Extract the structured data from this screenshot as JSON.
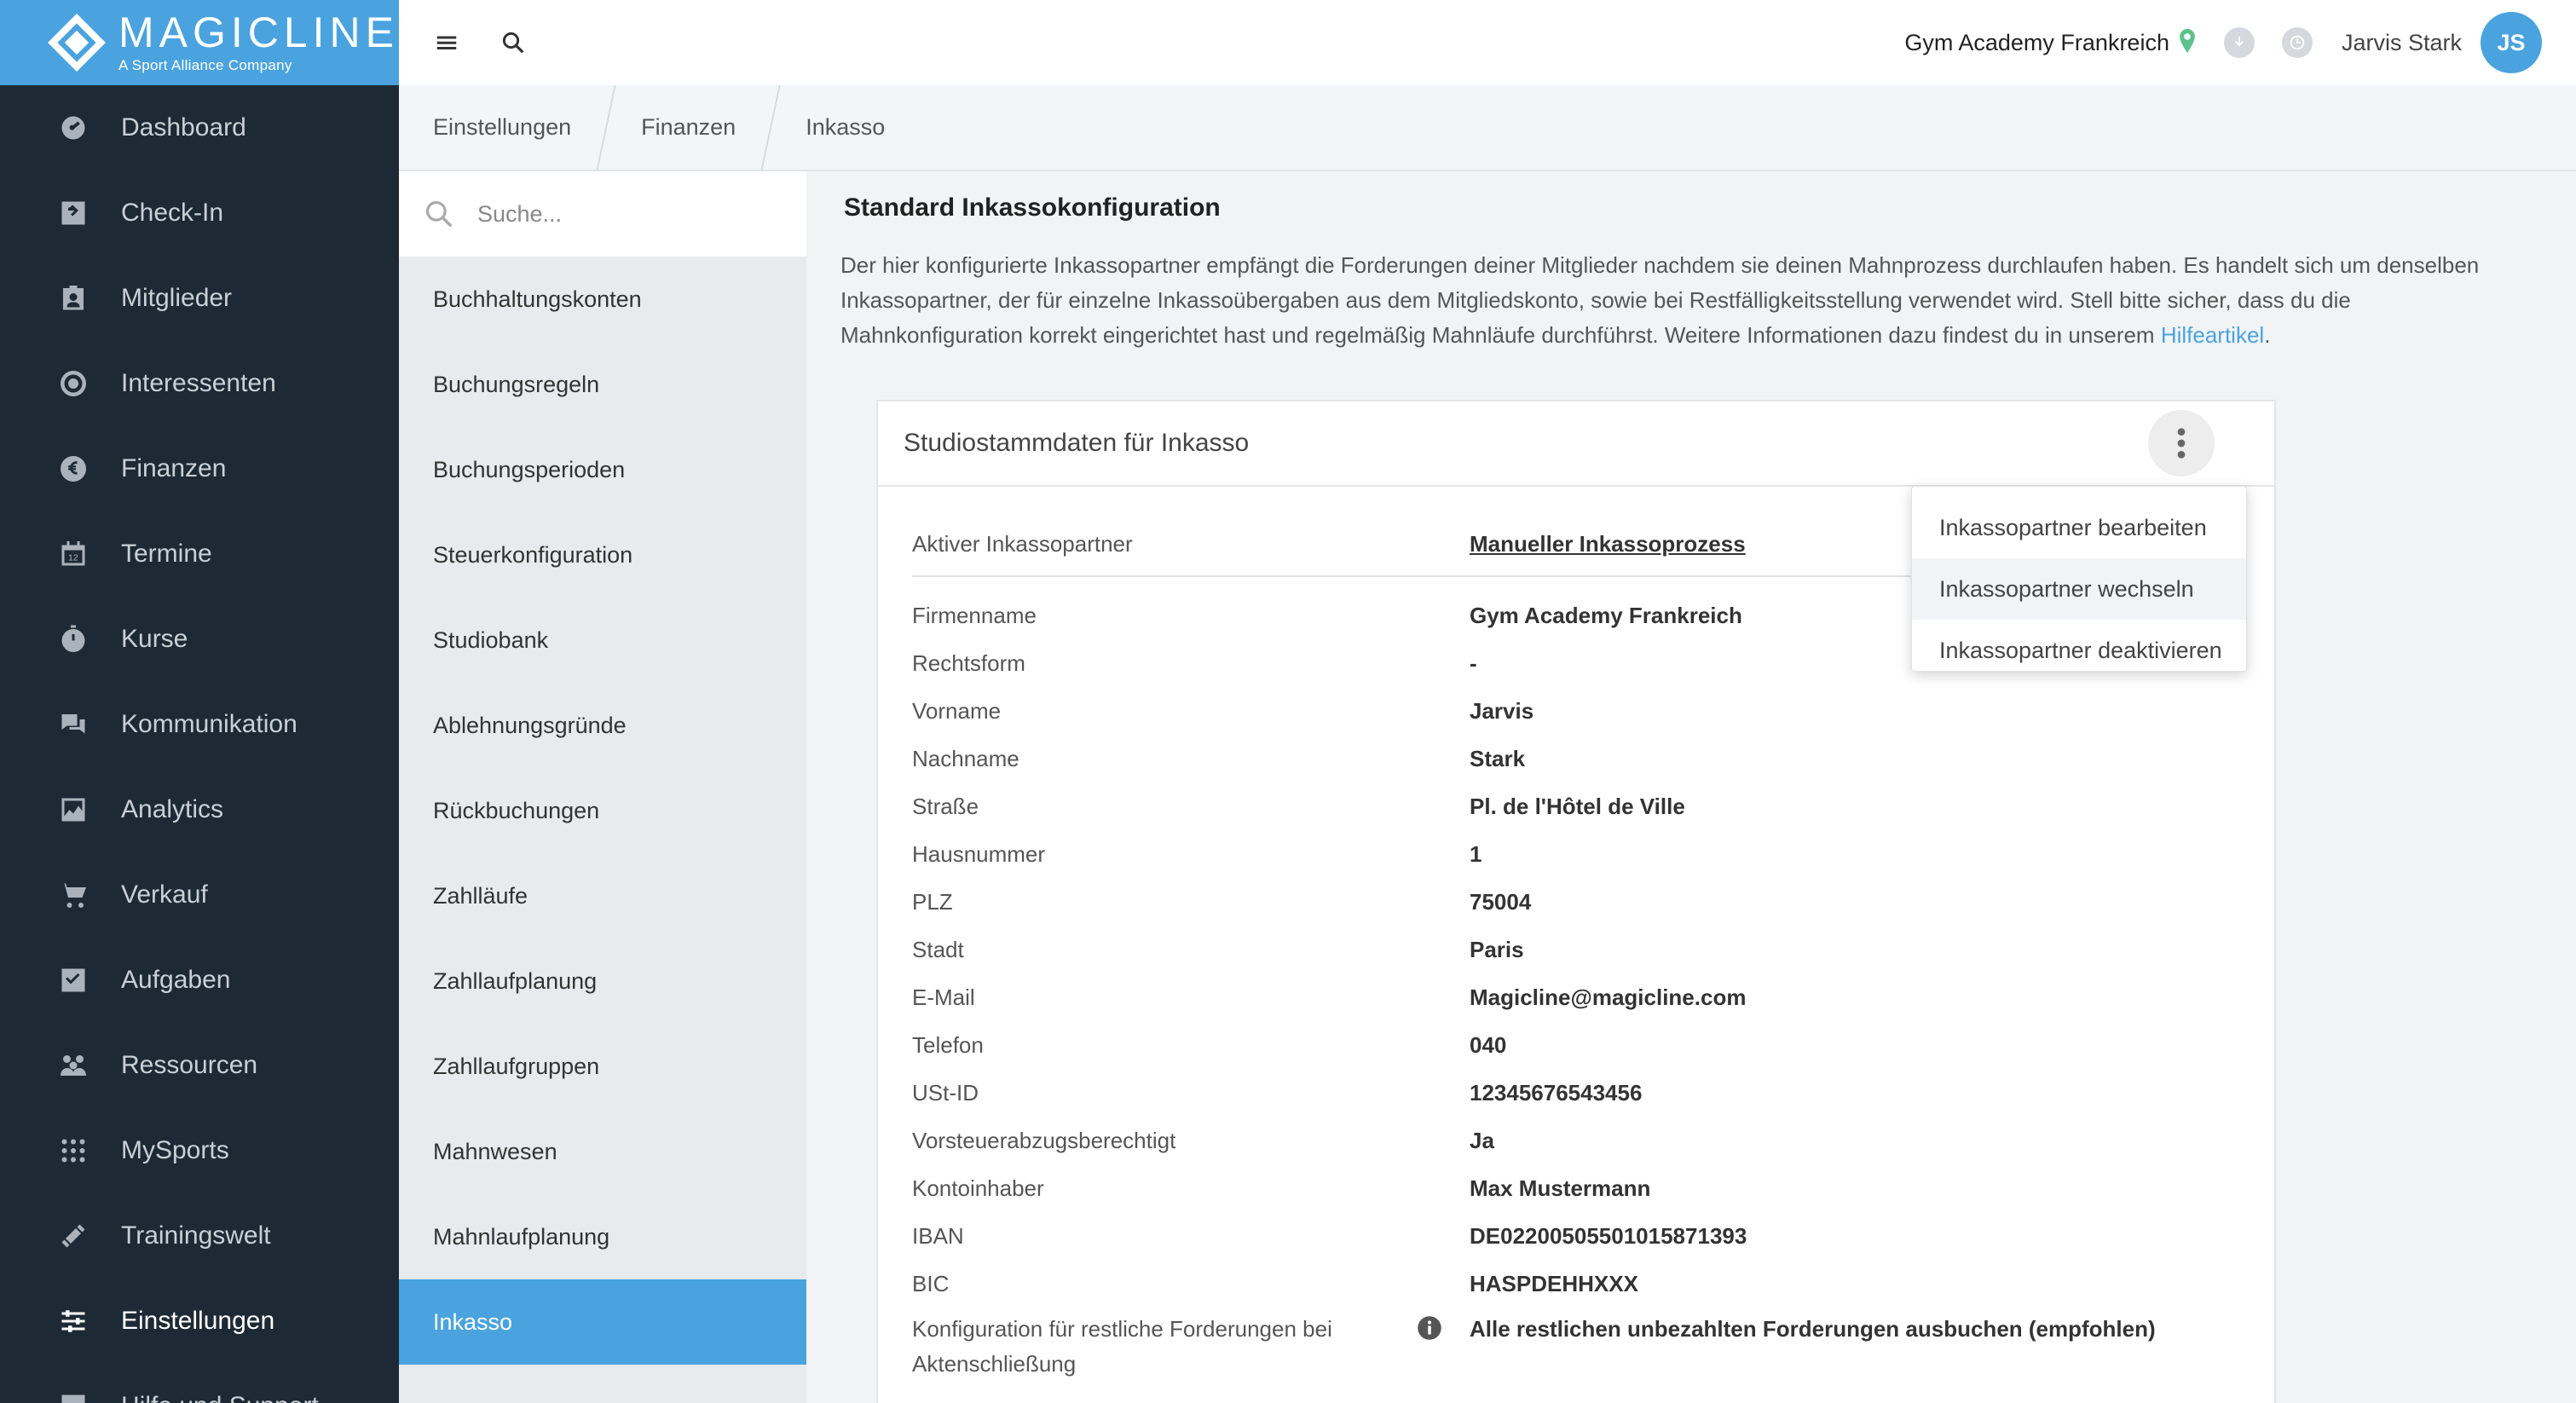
{
  "brand": {
    "name": "MAGICLINE",
    "tagline": "A Sport Alliance Company",
    "color": "#4aa3df"
  },
  "sidebar": {
    "items": [
      {
        "label": "Dashboard",
        "icon": "dashboard-icon"
      },
      {
        "label": "Check-In",
        "icon": "check-in-icon"
      },
      {
        "label": "Mitglieder",
        "icon": "members-icon"
      },
      {
        "label": "Interessenten",
        "icon": "prospects-icon"
      },
      {
        "label": "Finanzen",
        "icon": "euro-icon"
      },
      {
        "label": "Termine",
        "icon": "calendar-icon"
      },
      {
        "label": "Kurse",
        "icon": "stopwatch-icon"
      },
      {
        "label": "Kommunikation",
        "icon": "chat-icon"
      },
      {
        "label": "Analytics",
        "icon": "chart-icon"
      },
      {
        "label": "Verkauf",
        "icon": "cart-icon"
      },
      {
        "label": "Aufgaben",
        "icon": "checkbox-icon"
      },
      {
        "label": "Ressourcen",
        "icon": "people-icon"
      },
      {
        "label": "MySports",
        "icon": "dots-grid-icon"
      },
      {
        "label": "Trainingswelt",
        "icon": "dumbbell-icon"
      },
      {
        "label": "Einstellungen",
        "icon": "sliders-icon"
      },
      {
        "label": "Hilfe und Support",
        "icon": "help-icon"
      }
    ]
  },
  "topbar": {
    "studio": "Gym Academy Frankreich",
    "user_name": "Jarvis Stark",
    "avatar_initials": "JS"
  },
  "breadcrumb": [
    "Einstellungen",
    "Finanzen",
    "Inkasso"
  ],
  "subnav": {
    "search_placeholder": "Suche...",
    "items": [
      "Buchhaltungskonten",
      "Buchungsregeln",
      "Buchungsperioden",
      "Steuerkonfiguration",
      "Studiobank",
      "Ablehnungsgründe",
      "Rückbuchungen",
      "Zahlläufe",
      "Zahllaufplanung",
      "Zahllaufgruppen",
      "Mahnwesen",
      "Mahnlaufplanung",
      "Inkasso"
    ]
  },
  "main": {
    "title": "Standard Inkassokonfiguration",
    "description": "Der hier konfigurierte Inkassopartner empfängt die Forderungen deiner Mitglieder nachdem sie deinen Mahnprozess durchlaufen haben. Es handelt sich um denselben Inkassopartner, der für einzelne Inkassoübergaben aus dem Mitgliedskonto, sowie bei Restfälligkeitsstellung verwendet wird. Stell bitte sicher, dass du die Mahnkonfiguration korrekt eingerichtet hast und regelmäßig Mahnläufe durchführst. Weitere Informationen dazu findest du in unserem ",
    "help_link": "Hilfeartikel",
    "description_end": ".",
    "card": {
      "title": "Studiostammdaten für Inkasso",
      "active_label": "Aktiver Inkassopartner",
      "active_value": "Manueller Inkassoprozess",
      "fields": [
        {
          "label": "Firmenname",
          "value": "Gym Academy Frankreich"
        },
        {
          "label": "Rechtsform",
          "value": "-"
        },
        {
          "label": "Vorname",
          "value": "Jarvis"
        },
        {
          "label": "Nachname",
          "value": "Stark"
        },
        {
          "label": "Straße",
          "value": "Pl. de l'Hôtel de Ville"
        },
        {
          "label": "Hausnummer",
          "value": "1"
        },
        {
          "label": "PLZ",
          "value": "75004"
        },
        {
          "label": "Stadt",
          "value": "Paris"
        },
        {
          "label": "E-Mail",
          "value": "Magicline@magicline.com"
        },
        {
          "label": "Telefon",
          "value": "040"
        },
        {
          "label": "USt-ID",
          "value": "12345676543456"
        },
        {
          "label": "Vorsteuerabzugsberechtigt",
          "value": "Ja"
        },
        {
          "label": "Kontoinhaber",
          "value": "Max Mustermann"
        },
        {
          "label": "IBAN",
          "value": "DE02200505501015871393"
        },
        {
          "label": "BIC",
          "value": "HASPDEHHXXX"
        }
      ],
      "last_label": "Konfiguration für restliche Forderungen bei Aktenschließung",
      "last_value": "Alle restlichen unbezahlten Forderungen ausbuchen (empfohlen)"
    },
    "menu": [
      "Inkassopartner bearbeiten",
      "Inkassopartner wechseln",
      "Inkassopartner deaktivieren"
    ]
  }
}
